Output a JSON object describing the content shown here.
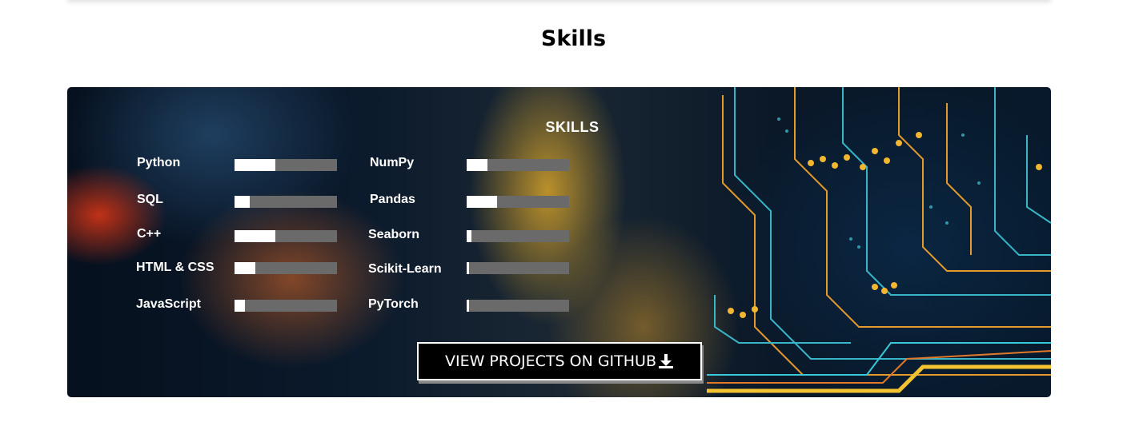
{
  "section": {
    "title": "Skills"
  },
  "banner": {
    "heading": "SKILLS",
    "left_skills": [
      {
        "label": "Python",
        "level": 0.4
      },
      {
        "label": "SQL",
        "level": 0.15
      },
      {
        "label": "C++",
        "level": 0.4
      },
      {
        "label": "HTML & CSS",
        "level": 0.2
      },
      {
        "label": "JavaScript",
        "level": 0.1
      }
    ],
    "right_skills": [
      {
        "label": "NumPy",
        "level": 0.2
      },
      {
        "label": "Pandas",
        "level": 0.3
      },
      {
        "label": "Seaborn",
        "level": 0.05
      },
      {
        "label": "Scikit-Learn",
        "level": 0.02
      },
      {
        "label": "PyTorch",
        "level": 0.02
      }
    ],
    "cta_label": "VIEW PROJECTS ON GITHUB",
    "cta_icon": "download-icon"
  },
  "colors": {
    "bar_track": "#6a6a6a",
    "bar_fill": "#ffffff",
    "cta_bg": "#000000"
  }
}
